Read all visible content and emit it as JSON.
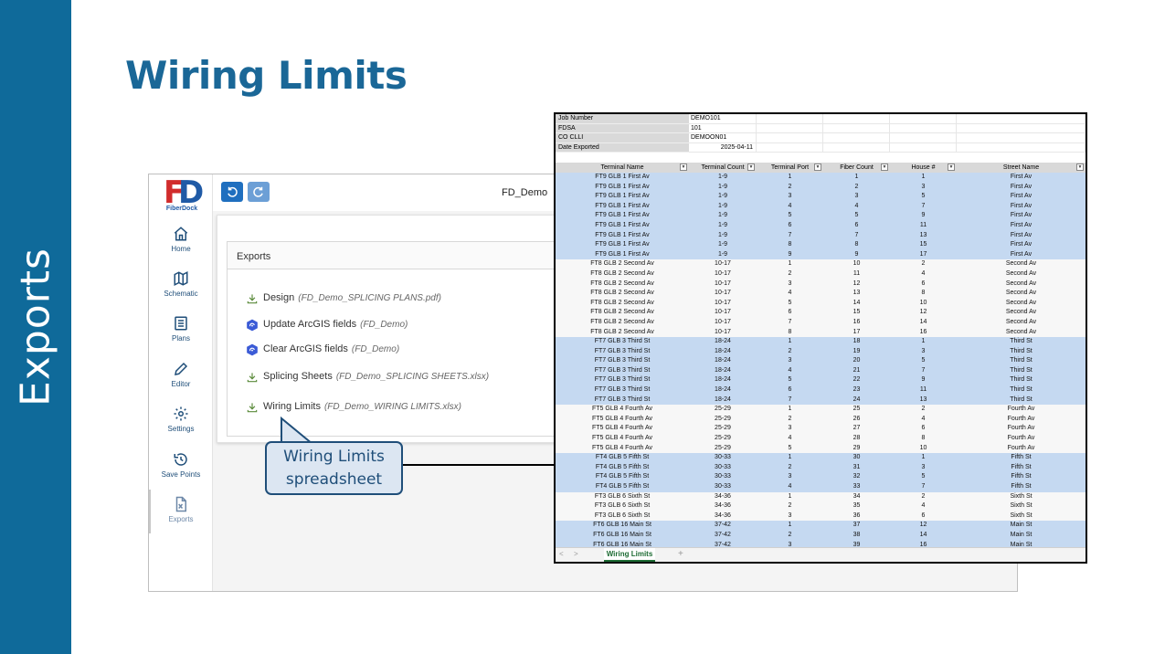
{
  "slide": {
    "side_label": "Exports",
    "title": "Wiring Limits"
  },
  "app": {
    "logo_word": "FiberDock",
    "project_name": "FD_Demo",
    "nav": [
      {
        "label": "Home",
        "icon": "home-icon"
      },
      {
        "label": "Schematic",
        "icon": "map-icon"
      },
      {
        "label": "Plans",
        "icon": "document-icon"
      },
      {
        "label": "Editor",
        "icon": "pencil-icon"
      },
      {
        "label": "Settings",
        "icon": "gear-icon"
      },
      {
        "label": "Save Points",
        "icon": "history-icon"
      },
      {
        "label": "Exports",
        "icon": "excel-file-icon"
      }
    ],
    "exports": {
      "header": "Exports",
      "items": [
        {
          "label": "Design",
          "file": "(FD_Demo_SPLICING PLANS.pdf)",
          "icon": "download-icon"
        },
        {
          "label": "Update ArcGIS fields",
          "file": "(FD_Demo)",
          "icon": "arcgis-icon"
        },
        {
          "label": "Clear ArcGIS fields",
          "file": "(FD_Demo)",
          "icon": "arcgis-icon"
        },
        {
          "label": "Splicing Sheets",
          "file": "(FD_Demo_SPLICING SHEETS.xlsx)",
          "icon": "download-icon"
        },
        {
          "label": "Wiring Limits",
          "file": "(FD_Demo_WIRING LIMITS.xlsx)",
          "icon": "download-icon"
        }
      ]
    }
  },
  "callout": {
    "line1": "Wiring Limits",
    "line2": "spreadsheet"
  },
  "sheet": {
    "meta": [
      {
        "key": "Job Number",
        "value": "DEMO101"
      },
      {
        "key": "FDSA",
        "value": "101"
      },
      {
        "key": "CO CLLI",
        "value": "DEMOON01"
      },
      {
        "key": "Date Exported",
        "value": "2025-04-11"
      }
    ],
    "columns": [
      "Terminal Name",
      "Terminal Count",
      "Terminal Port",
      "Fiber Count",
      "House #",
      "Street Name"
    ],
    "rows": [
      [
        "FT9 GLB 1 First Av",
        "1-9",
        "1",
        "1",
        "1",
        "First Av"
      ],
      [
        "FT9 GLB 1 First Av",
        "1-9",
        "2",
        "2",
        "3",
        "First Av"
      ],
      [
        "FT9 GLB 1 First Av",
        "1-9",
        "3",
        "3",
        "5",
        "First Av"
      ],
      [
        "FT9 GLB 1 First Av",
        "1-9",
        "4",
        "4",
        "7",
        "First Av"
      ],
      [
        "FT9 GLB 1 First Av",
        "1-9",
        "5",
        "5",
        "9",
        "First Av"
      ],
      [
        "FT9 GLB 1 First Av",
        "1-9",
        "6",
        "6",
        "11",
        "First Av"
      ],
      [
        "FT9 GLB 1 First Av",
        "1-9",
        "7",
        "7",
        "13",
        "First Av"
      ],
      [
        "FT9 GLB 1 First Av",
        "1-9",
        "8",
        "8",
        "15",
        "First Av"
      ],
      [
        "FT9 GLB 1 First Av",
        "1-9",
        "9",
        "9",
        "17",
        "First Av"
      ],
      [
        "FT8 GLB 2 Second Av",
        "10-17",
        "1",
        "10",
        "2",
        "Second Av"
      ],
      [
        "FT8 GLB 2 Second Av",
        "10-17",
        "2",
        "11",
        "4",
        "Second Av"
      ],
      [
        "FT8 GLB 2 Second Av",
        "10-17",
        "3",
        "12",
        "6",
        "Second Av"
      ],
      [
        "FT8 GLB 2 Second Av",
        "10-17",
        "4",
        "13",
        "8",
        "Second Av"
      ],
      [
        "FT8 GLB 2 Second Av",
        "10-17",
        "5",
        "14",
        "10",
        "Second Av"
      ],
      [
        "FT8 GLB 2 Second Av",
        "10-17",
        "6",
        "15",
        "12",
        "Second Av"
      ],
      [
        "FT8 GLB 2 Second Av",
        "10-17",
        "7",
        "16",
        "14",
        "Second Av"
      ],
      [
        "FT8 GLB 2 Second Av",
        "10-17",
        "8",
        "17",
        "16",
        "Second Av"
      ],
      [
        "FT7 GLB 3 Third St",
        "18-24",
        "1",
        "18",
        "1",
        "Third St"
      ],
      [
        "FT7 GLB 3 Third St",
        "18-24",
        "2",
        "19",
        "3",
        "Third St"
      ],
      [
        "FT7 GLB 3 Third St",
        "18-24",
        "3",
        "20",
        "5",
        "Third St"
      ],
      [
        "FT7 GLB 3 Third St",
        "18-24",
        "4",
        "21",
        "7",
        "Third St"
      ],
      [
        "FT7 GLB 3 Third St",
        "18-24",
        "5",
        "22",
        "9",
        "Third St"
      ],
      [
        "FT7 GLB 3 Third St",
        "18-24",
        "6",
        "23",
        "11",
        "Third St"
      ],
      [
        "FT7 GLB 3 Third St",
        "18-24",
        "7",
        "24",
        "13",
        "Third St"
      ],
      [
        "FT5 GLB 4 Fourth Av",
        "25-29",
        "1",
        "25",
        "2",
        "Fourth Av"
      ],
      [
        "FT5 GLB 4 Fourth Av",
        "25-29",
        "2",
        "26",
        "4",
        "Fourth Av"
      ],
      [
        "FT5 GLB 4 Fourth Av",
        "25-29",
        "3",
        "27",
        "6",
        "Fourth Av"
      ],
      [
        "FT5 GLB 4 Fourth Av",
        "25-29",
        "4",
        "28",
        "8",
        "Fourth Av"
      ],
      [
        "FT5 GLB 4 Fourth Av",
        "25-29",
        "5",
        "29",
        "10",
        "Fourth Av"
      ],
      [
        "FT4 GLB 5 Fifth St",
        "30-33",
        "1",
        "30",
        "1",
        "Fifth St"
      ],
      [
        "FT4 GLB 5 Fifth St",
        "30-33",
        "2",
        "31",
        "3",
        "Fifth St"
      ],
      [
        "FT4 GLB 5 Fifth St",
        "30-33",
        "3",
        "32",
        "5",
        "Fifth St"
      ],
      [
        "FT4 GLB 5 Fifth St",
        "30-33",
        "4",
        "33",
        "7",
        "Fifth St"
      ],
      [
        "FT3 GLB 6 Sixth St",
        "34-36",
        "1",
        "34",
        "2",
        "Sixth St"
      ],
      [
        "FT3 GLB 6 Sixth St",
        "34-36",
        "2",
        "35",
        "4",
        "Sixth St"
      ],
      [
        "FT3 GLB 6 Sixth St",
        "34-36",
        "3",
        "36",
        "6",
        "Sixth St"
      ],
      [
        "FT6 GLB 16 Main St",
        "37-42",
        "1",
        "37",
        "12",
        "Main St"
      ],
      [
        "FT6 GLB 16 Main St",
        "37-42",
        "2",
        "38",
        "14",
        "Main St"
      ],
      [
        "FT6 GLB 16 Main St",
        "37-42",
        "3",
        "39",
        "16",
        "Main St"
      ]
    ],
    "row_groups": [
      "alt",
      "alt",
      "alt",
      "alt",
      "alt",
      "alt",
      "alt",
      "alt",
      "alt",
      "plain",
      "plain",
      "plain",
      "plain",
      "plain",
      "plain",
      "plain",
      "plain",
      "alt",
      "alt",
      "alt",
      "alt",
      "alt",
      "alt",
      "alt",
      "plain",
      "plain",
      "plain",
      "plain",
      "plain",
      "alt",
      "alt",
      "alt",
      "alt",
      "plain",
      "plain",
      "plain",
      "alt",
      "alt",
      "alt"
    ],
    "tab": {
      "active": "Wiring Limits",
      "prev": "<",
      "next": ">",
      "add": "+"
    }
  },
  "colors": {
    "brand_blue": "#0f6a9a",
    "title_blue": "#1a6797",
    "row_highlight": "#c5d9f1",
    "excel_green": "#1d6b33"
  }
}
